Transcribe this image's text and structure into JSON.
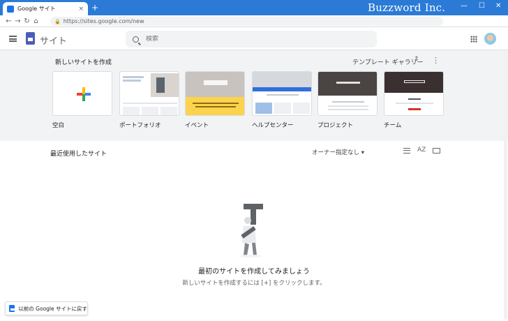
{
  "browser": {
    "tab_title": "Google サイト",
    "tab_close": "×",
    "new_tab": "+",
    "url": "https://sites.google.com/new",
    "watermark": "Buzzword Inc.",
    "window_controls": [
      "—",
      "☐",
      "✕"
    ]
  },
  "header": {
    "app_title": "サイト",
    "search_placeholder": "検索"
  },
  "templates": {
    "section_title": "新しいサイトを作成",
    "gallery_label": "テンプレート ギャラリー",
    "items": [
      {
        "label": "空白"
      },
      {
        "label": "ポートフォリオ"
      },
      {
        "label": "イベント"
      },
      {
        "label": "ヘルプセンター"
      },
      {
        "label": "プロジェクト"
      },
      {
        "label": "チーム"
      }
    ]
  },
  "recent": {
    "title": "最近使用したサイト",
    "owner_filter": "オーナー指定なし ▾",
    "sort_label": "AZ"
  },
  "empty_state": {
    "title": "最初のサイトを作成してみましょう",
    "subtitle": "新しいサイトを作成するには [+] をクリックします。"
  },
  "classic_link": {
    "label": "以前の Google サイトに戻す"
  },
  "colors": {
    "chrome_blue": "#2b7bd6",
    "band_gray": "#f1f3f4",
    "sites_purple": "#4b5eb7"
  }
}
